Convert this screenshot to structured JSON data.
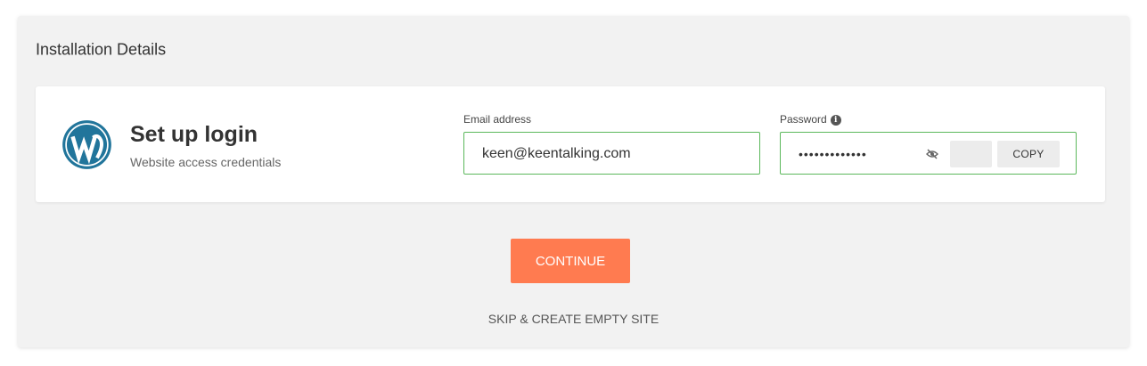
{
  "panel": {
    "title": "Installation Details"
  },
  "card": {
    "icon": "wordpress-icon",
    "title": "Set up login",
    "subtitle": "Website access credentials"
  },
  "email": {
    "label": "Email address",
    "value": "keen@keentalking.com"
  },
  "password": {
    "label": "Password",
    "info_icon": "info-icon",
    "masked_value": "•••••••••••••",
    "visibility_icon": "eye-slash-icon",
    "copy_label": "COPY"
  },
  "actions": {
    "continue_label": "CONTINUE",
    "skip_label": "SKIP & CREATE EMPTY SITE"
  },
  "colors": {
    "accent": "#ff7b50",
    "valid_border": "#5cb85c",
    "wordpress_blue": "#21759b"
  }
}
